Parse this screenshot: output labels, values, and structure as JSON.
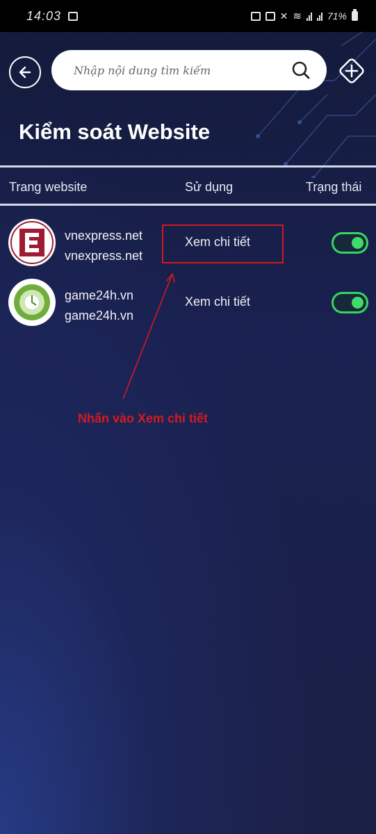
{
  "status_bar": {
    "time": "14:03",
    "battery": "71%"
  },
  "search": {
    "placeholder": "Nhập nội dung tìm kiếm"
  },
  "page": {
    "title": "Kiểm soát Website"
  },
  "table": {
    "headers": {
      "site": "Trang website",
      "use": "Sử dụng",
      "status": "Trạng thái"
    },
    "rows": [
      {
        "name": "vnexpress.net",
        "domain": "vnexpress.net",
        "action": "Xem chi tiết",
        "enabled": true,
        "logo": "vnexpress-logo-icon"
      },
      {
        "name": "game24h.vn",
        "domain": "game24h.vn",
        "action": "Xem chi tiết",
        "enabled": true,
        "logo": "game24h-logo-icon"
      }
    ]
  },
  "annotation": {
    "text": "Nhấn vào Xem chi tiết"
  },
  "colors": {
    "accent_green": "#34d860",
    "annotation_red": "#d41822",
    "background": "#1b2046"
  }
}
